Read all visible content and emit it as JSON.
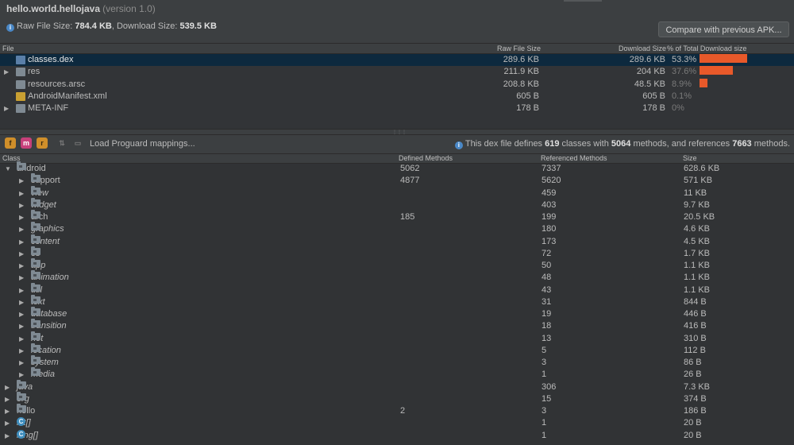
{
  "header": {
    "package": "hello.world.hellojava",
    "version": "(version 1.0)",
    "raw_label": "Raw File Size:",
    "raw_value": "784.4 KB",
    "download_label": ", Download Size:",
    "download_value": "539.5 KB",
    "compare_button": "Compare with previous APK..."
  },
  "file_table": {
    "columns": {
      "file": "File",
      "raw": "Raw File Size",
      "download": "Download Size",
      "percent": "% of Total Download size"
    },
    "rows": [
      {
        "name": "classes.dex",
        "raw": "289.6 KB",
        "download": "289.6 KB",
        "percent": "53.3%",
        "share": 0.533,
        "selected": true,
        "expandable": false,
        "icon": "dex-file-icon"
      },
      {
        "name": "res",
        "raw": "211.9 KB",
        "download": "204 KB",
        "percent": "37.6%",
        "share": 0.376,
        "selected": false,
        "expandable": true,
        "icon": "folder-icon"
      },
      {
        "name": "resources.arsc",
        "raw": "208.8 KB",
        "download": "48.5 KB",
        "percent": "8.9%",
        "share": 0.089,
        "selected": false,
        "expandable": false,
        "icon": "arsc-file-icon"
      },
      {
        "name": "AndroidManifest.xml",
        "raw": "605 B",
        "download": "605 B",
        "percent": "0.1%",
        "share": 0.001,
        "selected": false,
        "expandable": false,
        "icon": "xml-file-icon"
      },
      {
        "name": "META-INF",
        "raw": "178 B",
        "download": "178 B",
        "percent": "0%",
        "share": 0,
        "selected": false,
        "expandable": true,
        "icon": "folder-icon"
      }
    ]
  },
  "toolbar": {
    "load_proguard": "Load Proguard mappings...",
    "summary_prefix": "This dex file defines",
    "classes": "619",
    "classes_word": "classes with",
    "methods": "5064",
    "methods_word": "methods, and references",
    "references": "7663",
    "references_word": "methods."
  },
  "class_tree": {
    "columns": {
      "class": "Class",
      "defined": "Defined Methods",
      "referenced": "Referenced Methods",
      "size": "Size"
    },
    "rows": [
      {
        "name": "android",
        "defined": "5062",
        "referenced": "7337",
        "size": "628.6 KB",
        "level": 0,
        "expanded": true,
        "italic": false,
        "kind": "folder"
      },
      {
        "name": "support",
        "defined": "4877",
        "referenced": "5620",
        "size": "571 KB",
        "level": 1,
        "expanded": false,
        "italic": false,
        "kind": "folder"
      },
      {
        "name": "view",
        "defined": "",
        "referenced": "459",
        "size": "11 KB",
        "level": 1,
        "expanded": false,
        "italic": true,
        "kind": "folder"
      },
      {
        "name": "widget",
        "defined": "",
        "referenced": "403",
        "size": "9.7 KB",
        "level": 1,
        "expanded": false,
        "italic": true,
        "kind": "folder"
      },
      {
        "name": "arch",
        "defined": "185",
        "referenced": "199",
        "size": "20.5 KB",
        "level": 1,
        "expanded": false,
        "italic": false,
        "kind": "folder"
      },
      {
        "name": "graphics",
        "defined": "",
        "referenced": "180",
        "size": "4.6 KB",
        "level": 1,
        "expanded": false,
        "italic": true,
        "kind": "folder"
      },
      {
        "name": "content",
        "defined": "",
        "referenced": "173",
        "size": "4.5 KB",
        "level": 1,
        "expanded": false,
        "italic": true,
        "kind": "folder"
      },
      {
        "name": "os",
        "defined": "",
        "referenced": "72",
        "size": "1.7 KB",
        "level": 1,
        "expanded": false,
        "italic": true,
        "kind": "folder"
      },
      {
        "name": "app",
        "defined": "",
        "referenced": "50",
        "size": "1.1 KB",
        "level": 1,
        "expanded": false,
        "italic": true,
        "kind": "folder"
      },
      {
        "name": "animation",
        "defined": "",
        "referenced": "48",
        "size": "1.1 KB",
        "level": 1,
        "expanded": false,
        "italic": true,
        "kind": "folder"
      },
      {
        "name": "util",
        "defined": "",
        "referenced": "43",
        "size": "1.1 KB",
        "level": 1,
        "expanded": false,
        "italic": true,
        "kind": "folder"
      },
      {
        "name": "text",
        "defined": "",
        "referenced": "31",
        "size": "844 B",
        "level": 1,
        "expanded": false,
        "italic": true,
        "kind": "folder"
      },
      {
        "name": "database",
        "defined": "",
        "referenced": "19",
        "size": "446 B",
        "level": 1,
        "expanded": false,
        "italic": true,
        "kind": "folder"
      },
      {
        "name": "transition",
        "defined": "",
        "referenced": "18",
        "size": "416 B",
        "level": 1,
        "expanded": false,
        "italic": true,
        "kind": "folder"
      },
      {
        "name": "net",
        "defined": "",
        "referenced": "13",
        "size": "310 B",
        "level": 1,
        "expanded": false,
        "italic": true,
        "kind": "folder"
      },
      {
        "name": "location",
        "defined": "",
        "referenced": "5",
        "size": "112 B",
        "level": 1,
        "expanded": false,
        "italic": true,
        "kind": "folder"
      },
      {
        "name": "system",
        "defined": "",
        "referenced": "3",
        "size": "86 B",
        "level": 1,
        "expanded": false,
        "italic": true,
        "kind": "folder"
      },
      {
        "name": "media",
        "defined": "",
        "referenced": "1",
        "size": "26 B",
        "level": 1,
        "expanded": false,
        "italic": true,
        "kind": "folder"
      },
      {
        "name": "java",
        "defined": "",
        "referenced": "306",
        "size": "7.3 KB",
        "level": 0,
        "expanded": false,
        "italic": true,
        "kind": "folder"
      },
      {
        "name": "org",
        "defined": "",
        "referenced": "15",
        "size": "374 B",
        "level": 0,
        "expanded": false,
        "italic": true,
        "kind": "folder"
      },
      {
        "name": "hello",
        "defined": "2",
        "referenced": "3",
        "size": "186 B",
        "level": 0,
        "expanded": false,
        "italic": false,
        "kind": "folder"
      },
      {
        "name": "int[]",
        "defined": "",
        "referenced": "1",
        "size": "20 B",
        "level": 0,
        "expanded": false,
        "italic": true,
        "kind": "class"
      },
      {
        "name": "long[]",
        "defined": "",
        "referenced": "1",
        "size": "20 B",
        "level": 0,
        "expanded": false,
        "italic": true,
        "kind": "class"
      }
    ]
  }
}
